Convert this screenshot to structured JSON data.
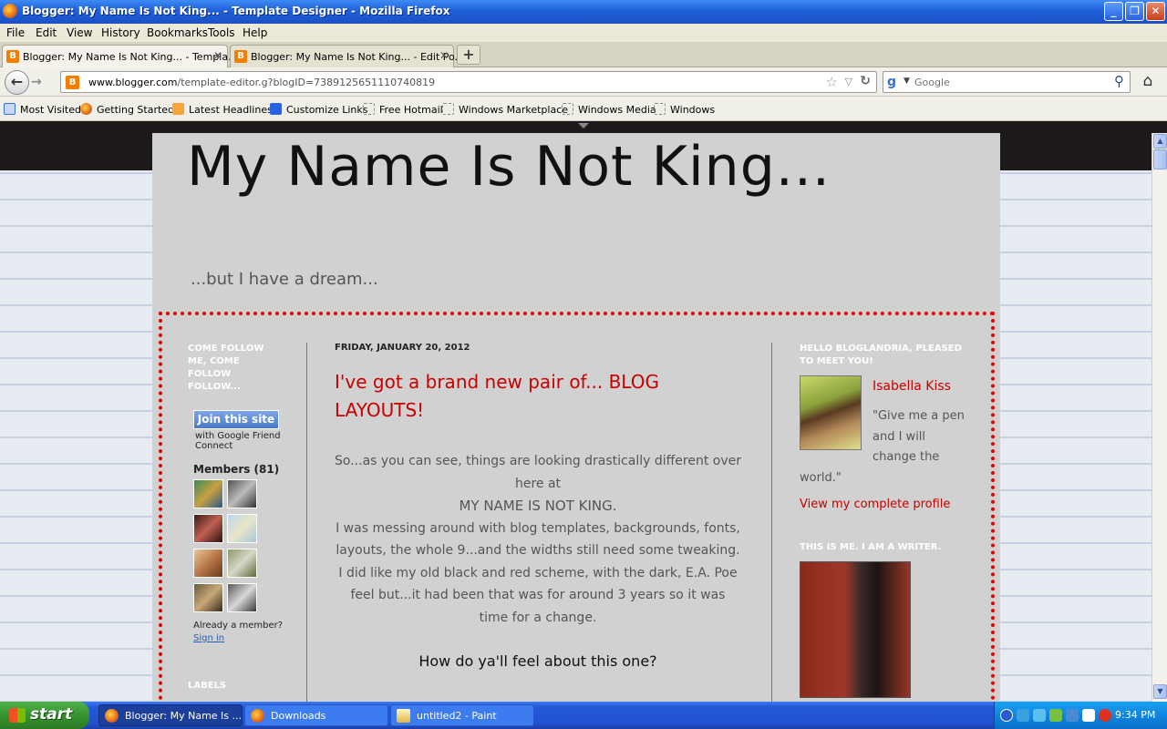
{
  "window": {
    "title": "Blogger: My Name Is Not King... - Template Designer - Mozilla Firefox",
    "min": "_",
    "max": "❐",
    "close": "✕"
  },
  "menu": [
    "File",
    "Edit",
    "View",
    "History",
    "Bookmarks",
    "Tools",
    "Help"
  ],
  "tabs": [
    {
      "label": "Blogger: My Name Is Not King... - Templa...",
      "close": "✕",
      "icon": "B"
    },
    {
      "label": "Blogger: My Name Is Not King... - Edit Po...",
      "close": "✕",
      "icon": "B"
    }
  ],
  "newtab": "+",
  "nav": {
    "back": "←",
    "forward": "→",
    "url_domain": "www.blogger.com",
    "url_path": "/template-editor.g?blogID=7389125651110740819",
    "search_engine": "g",
    "search_placeholder": "Google"
  },
  "bookmarks": [
    "Most Visited",
    "Getting Started",
    "Latest Headlines",
    "Customize Links",
    "Free Hotmail",
    "Windows Marketplace",
    "Windows Media",
    "Windows"
  ],
  "blog": {
    "title": "My Name Is Not King...",
    "description": "...but I have a dream...",
    "left": {
      "follow_title": "COME FOLLOW ME, COME FOLLOW FOLLOW...",
      "join": "Join this site",
      "gfc": "with Google Friend Connect",
      "members": "Members (81)",
      "already": "Already a member?",
      "signin": "Sign in",
      "labels": "LABELS"
    },
    "post": {
      "date": "FRIDAY, JANUARY 20, 2012",
      "title": "I've got a brand new pair of... BLOG LAYOUTS!",
      "p1": "So...as you can see, things are looking drastically different over here at",
      "p2": "MY NAME IS NOT KING.",
      "p3": "I was messing around with blog templates, backgrounds, fonts, layouts, the whole 9...and the widths still need some tweaking. I did like my old black and red scheme, with the dark, E.A. Poe feel but...it had been that was for around 3 years so it was time for a change.",
      "question": "How do ya'll feel about this one?"
    },
    "right": {
      "hello_title": "HELLO BLOGLANDRIA, PLEASED TO MEET YOU!",
      "name": "Isabella Kiss",
      "quote_line1": "\"Give me a pen",
      "quote_line2": "and I will",
      "quote_line3": "change the",
      "quote_line4": "world.\"",
      "profile_link": "View my complete profile",
      "writer_title": "THIS IS ME. I AM A WRITER."
    }
  },
  "taskbar": {
    "start": "start",
    "tasks": [
      "Blogger: My Name Is ...",
      "Downloads",
      "untitled2 - Paint"
    ],
    "clock": "9:34 PM"
  },
  "colors": {
    "accent_red": "#c80000",
    "frame_red": "#e00000",
    "blog_bg": "#d1d1d1"
  }
}
